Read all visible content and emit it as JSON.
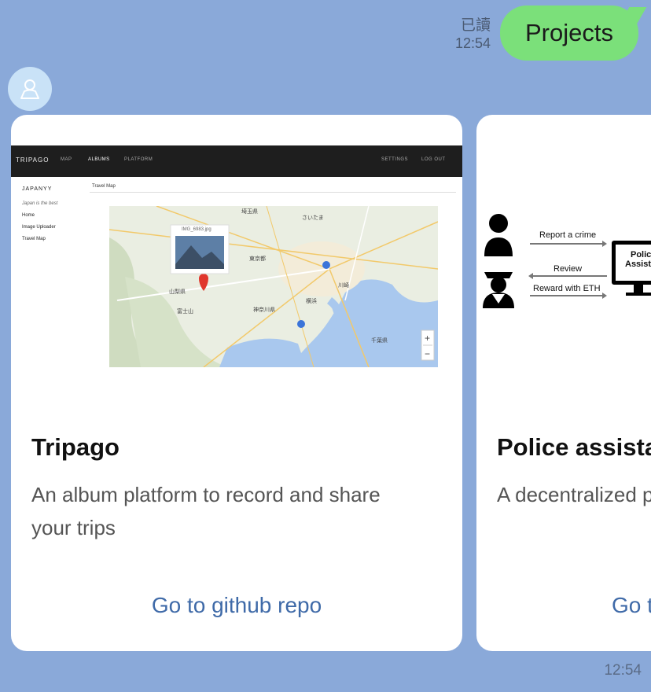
{
  "outgoing": {
    "read_label": "已讀",
    "time": "12:54",
    "text": "Projects"
  },
  "cards": [
    {
      "title": "Tripago",
      "description": "An album platform to record and share your trips",
      "link": "Go to github repo",
      "screenshot": {
        "brand": "TRIPAGO",
        "nav": [
          "MAP",
          "ALBUMS",
          "PLATFORM"
        ],
        "nav_right": [
          "SETTINGS",
          "LOG OUT"
        ],
        "site_name": "JAPANYY",
        "tagline": "Japan is the best",
        "menu": [
          "Home",
          "Image Uploader",
          "Travel Map"
        ],
        "breadcrumb": "Travel Map",
        "popup_filename": "IMG_6983.jpg",
        "map_labels": [
          "埼玉県",
          "さいたま",
          "東京都",
          "山梨県",
          "神奈川県",
          "横浜",
          "千葉県",
          "富士山",
          "川崎"
        ]
      }
    },
    {
      "title": "Police assista",
      "description": "A decentralized p",
      "link": "Go t",
      "diagram": {
        "labels": [
          "Report a crime",
          "Review",
          "Reward with ETH"
        ],
        "screen_text": [
          "Polic",
          "Assista"
        ]
      }
    }
  ],
  "bottom_time": "12:54",
  "colors": {
    "background": "#8aa9d9",
    "bubble": "#7be07a",
    "link": "#3f6aa8",
    "avatar": "#c9e2f7"
  }
}
